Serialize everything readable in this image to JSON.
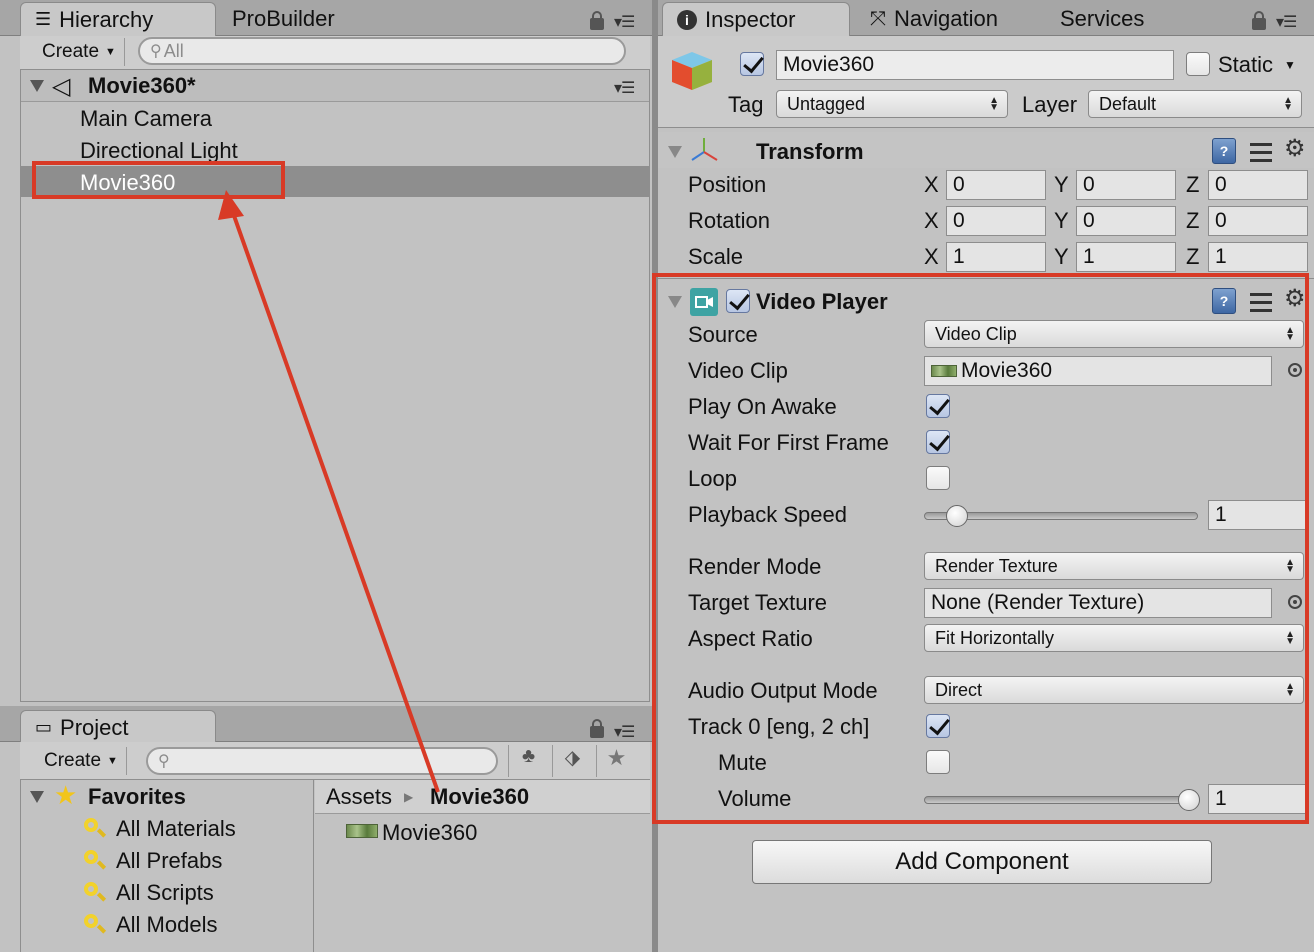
{
  "hierarchy": {
    "tabs": [
      {
        "label": "Hierarchy"
      },
      {
        "label": "ProBuilder"
      }
    ],
    "create_label": "Create",
    "search_placeholder": "All",
    "scene_name": "Movie360*",
    "items": [
      {
        "label": "Main Camera"
      },
      {
        "label": "Directional Light"
      },
      {
        "label": "Movie360"
      }
    ]
  },
  "project": {
    "tab_label": "Project",
    "create_label": "Create",
    "favorites_label": "Favorites",
    "favorites": [
      {
        "label": "All Materials"
      },
      {
        "label": "All Prefabs"
      },
      {
        "label": "All Scripts"
      },
      {
        "label": "All Models"
      }
    ],
    "breadcrumb": {
      "root": "Assets",
      "current": "Movie360"
    },
    "assets": [
      {
        "label": "Movie360"
      }
    ]
  },
  "inspector": {
    "tabs": [
      {
        "label": "Inspector"
      },
      {
        "label": "Navigation"
      },
      {
        "label": "Services"
      }
    ],
    "object_name": "Movie360",
    "static_label": "Static",
    "tag_label": "Tag",
    "tag_value": "Untagged",
    "layer_label": "Layer",
    "layer_value": "Default",
    "transform": {
      "title": "Transform",
      "rows": [
        {
          "label": "Position",
          "x": "0",
          "y": "0",
          "z": "0"
        },
        {
          "label": "Rotation",
          "x": "0",
          "y": "0",
          "z": "0"
        },
        {
          "label": "Scale",
          "x": "1",
          "y": "1",
          "z": "1"
        }
      ],
      "axis_x": "X",
      "axis_y": "Y",
      "axis_z": "Z"
    },
    "video_player": {
      "title": "Video Player",
      "source_label": "Source",
      "source_value": "Video Clip",
      "video_clip_label": "Video Clip",
      "video_clip_value": "Movie360",
      "play_on_awake_label": "Play On Awake",
      "play_on_awake": true,
      "wait_first_frame_label": "Wait For First Frame",
      "wait_first_frame": true,
      "loop_label": "Loop",
      "loop": false,
      "playback_speed_label": "Playback Speed",
      "playback_speed_value": "1",
      "render_mode_label": "Render Mode",
      "render_mode_value": "Render Texture",
      "target_texture_label": "Target Texture",
      "target_texture_value": "None (Render Texture)",
      "aspect_ratio_label": "Aspect Ratio",
      "aspect_ratio_value": "Fit Horizontally",
      "audio_output_label": "Audio Output Mode",
      "audio_output_value": "Direct",
      "track_label": "Track 0 [eng, 2 ch]",
      "track_enabled": true,
      "mute_label": "Mute",
      "mute": false,
      "volume_label": "Volume",
      "volume_value": "1"
    },
    "add_component_label": "Add Component"
  },
  "colors": {
    "annotation": "#d83a26",
    "selection": "#8e8e8e"
  }
}
